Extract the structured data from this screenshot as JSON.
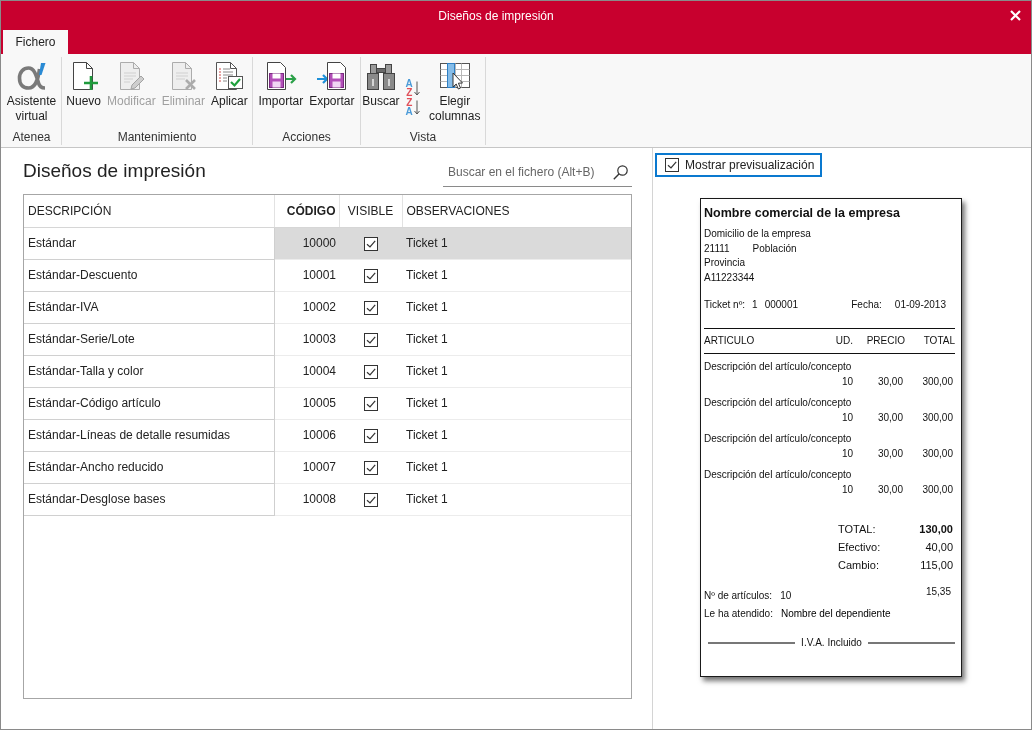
{
  "window": {
    "title": "Diseños de impresión"
  },
  "ribbon_tabs": [
    {
      "label": "Fichero",
      "selected": true
    }
  ],
  "ribbon_groups": [
    {
      "label": "Atenea",
      "buttons": [
        {
          "kind": "large",
          "label": "Asistente virtual",
          "disabled": false
        }
      ]
    },
    {
      "label": "Mantenimiento",
      "buttons": [
        {
          "kind": "large",
          "label": "Nuevo",
          "disabled": false
        },
        {
          "kind": "large",
          "label": "Modificar",
          "disabled": true
        },
        {
          "kind": "large",
          "label": "Eliminar",
          "disabled": true
        },
        {
          "kind": "large",
          "label": "Aplicar",
          "disabled": false
        }
      ]
    },
    {
      "label": "Acciones",
      "buttons": [
        {
          "kind": "large",
          "label": "Importar",
          "disabled": false
        },
        {
          "kind": "large",
          "label": "Exportar",
          "disabled": false
        }
      ]
    },
    {
      "label": "Vista",
      "buttons": [
        {
          "kind": "large",
          "label": "Buscar",
          "disabled": false
        },
        {
          "kind": "sort",
          "letters": [
            {
              "text": "A",
              "color": "#4a9ad8"
            },
            {
              "text": "Z",
              "color": "#e0505a"
            }
          ]
        },
        {
          "kind": "sort",
          "letters": [
            {
              "text": "Z",
              "color": "#e0505a"
            },
            {
              "text": "A",
              "color": "#4a9ad8"
            }
          ]
        },
        {
          "kind": "large",
          "label": "Elegir columnas",
          "disabled": false
        }
      ]
    }
  ],
  "list": {
    "title": "Diseños de impresión",
    "search": {
      "placeholder": "Buscar en el fichero (Alt+B)"
    },
    "columns": [
      {
        "label": "DESCRIPCIÓN",
        "kind": "text",
        "sorted": false
      },
      {
        "label": "CÓDIGO",
        "kind": "number",
        "sorted": true
      },
      {
        "label": "VISIBLE",
        "kind": "check",
        "sorted": false
      },
      {
        "label": "OBSERVACIONES",
        "kind": "text",
        "sorted": false
      }
    ],
    "rows": [
      {
        "selected": true,
        "cells": [
          {
            "text": "Estándar"
          },
          {
            "text": "10000"
          },
          {
            "checked": true
          },
          {
            "text": "Ticket 1"
          }
        ]
      },
      {
        "selected": false,
        "cells": [
          {
            "text": "Estándar-Descuento"
          },
          {
            "text": "10001"
          },
          {
            "checked": true
          },
          {
            "text": "Ticket 1"
          }
        ]
      },
      {
        "selected": false,
        "cells": [
          {
            "text": "Estándar-IVA"
          },
          {
            "text": "10002"
          },
          {
            "checked": true
          },
          {
            "text": "Ticket 1"
          }
        ]
      },
      {
        "selected": false,
        "cells": [
          {
            "text": "Estándar-Serie/Lote"
          },
          {
            "text": "10003"
          },
          {
            "checked": true
          },
          {
            "text": "Ticket 1"
          }
        ]
      },
      {
        "selected": false,
        "cells": [
          {
            "text": "Estándar-Talla y color"
          },
          {
            "text": "10004"
          },
          {
            "checked": true
          },
          {
            "text": "Ticket 1"
          }
        ]
      },
      {
        "selected": false,
        "cells": [
          {
            "text": "Estándar-Código artículo"
          },
          {
            "text": "10005"
          },
          {
            "checked": true
          },
          {
            "text": "Ticket 1"
          }
        ]
      },
      {
        "selected": false,
        "cells": [
          {
            "text": "Estándar-Líneas de detalle resumidas"
          },
          {
            "text": "10006"
          },
          {
            "checked": true
          },
          {
            "text": "Ticket 1"
          }
        ]
      },
      {
        "selected": false,
        "cells": [
          {
            "text": "Estándar-Ancho reducido"
          },
          {
            "text": "10007"
          },
          {
            "checked": true
          },
          {
            "text": "Ticket 1"
          }
        ]
      },
      {
        "selected": false,
        "cells": [
          {
            "text": "Estándar-Desglose bases"
          },
          {
            "text": "10008"
          },
          {
            "checked": true
          },
          {
            "text": "Ticket 1"
          }
        ]
      }
    ]
  },
  "preview": {
    "toggle": {
      "label": "Mostrar previsualización",
      "checked": true,
      "focused": true
    },
    "ticket": {
      "company_name": "Nombre comercial de la empresa",
      "address": "Domicilio de la empresa",
      "postal_code": "21111",
      "city": "Población",
      "province": "Provincia",
      "tax_id": "A11223344",
      "ticket_label": "Ticket nº:",
      "ticket_series": "1",
      "ticket_number": "000001",
      "date_label": "Fecha:",
      "date": "01-09-2013",
      "columns": [
        "ARTICULO",
        "UD.",
        "PRECIO",
        "TOTAL"
      ],
      "lines": [
        {
          "description": "Descripción del artículo/concepto",
          "units": "10",
          "price": "30,00",
          "total": "300,00"
        },
        {
          "description": "Descripción del artículo/concepto",
          "units": "10",
          "price": "30,00",
          "total": "300,00"
        },
        {
          "description": "Descripción del artículo/concepto",
          "units": "10",
          "price": "30,00",
          "total": "300,00"
        },
        {
          "description": "Descripción del artículo/concepto",
          "units": "10",
          "price": "30,00",
          "total": "300,00"
        }
      ],
      "totals": [
        {
          "label": "TOTAL:",
          "value": "130,00",
          "emphasis": true
        },
        {
          "label": "Efectivo:",
          "value": "40,00",
          "emphasis": false
        },
        {
          "label": "Cambio:",
          "value": "115,00",
          "emphasis": false
        }
      ],
      "loose_amount": "15,35",
      "item_count_label": "Nº de artículos:",
      "item_count": "10",
      "attended_label": "Le ha atendido:",
      "attended_by": "Nombre del dependiente",
      "footer": "I.V.A. Incluido"
    }
  }
}
